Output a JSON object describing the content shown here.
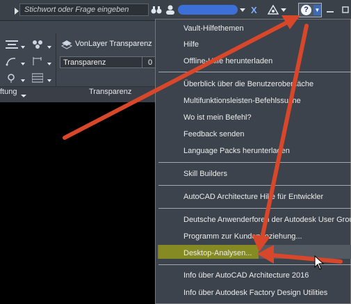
{
  "topbar": {
    "search_placeholder": "Stichwort oder Frage eingeben",
    "help_symbol": "?",
    "x_symbol": "X"
  },
  "ribbon": {
    "layer_transparency": "VonLayer Transparenz",
    "transparency_field": "Transparenz",
    "value_field": "0",
    "left_panel_label": "ftung",
    "right_panel_label": "Transparenz"
  },
  "menu": {
    "items": [
      "Vault-Hilfethemen",
      "Hilfe",
      "Offline-Hilfe herunterladen",
      "Überblick über die Benutzeroberfläche",
      "Multifunktionsleisten-Befehlssuche",
      "Wo ist mein Befehl?",
      "Feedback senden",
      "Language Packs herunterladen",
      "Skill Builders",
      "AutoCAD Architecture Hilfe für Entwickler",
      "Deutsche Anwenderforen der Autodesk User Group",
      "Programm zur Kundenbeziehung...",
      "Desktop-Analysen...",
      "Info über AutoCAD Architecture 2016",
      "Info über Autodesk Factory Design Utilities"
    ]
  },
  "colors": {
    "annotation_arrow": "#d9472b",
    "highlight_yellow": "#a0a500",
    "menu_bg": "#3c434c"
  }
}
